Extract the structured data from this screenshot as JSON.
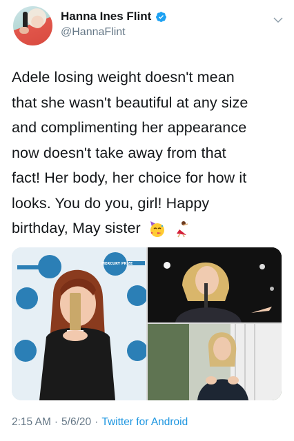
{
  "author": {
    "display_name": "Hanna Ines Flint",
    "handle": "@HannaFlint",
    "verified": true,
    "avatar_icon": "profile-photo"
  },
  "tweet": {
    "text_lines": [
      "Adele losing weight doesn't mean",
      "that she wasn't beautiful at any size",
      "and complimenting her appearance",
      "now doesn't take away from that",
      "fact! Her body, her choice for how it",
      "looks. You do you, girl! Happy",
      "birthday, May sister"
    ],
    "emojis": [
      "partying-face-emoji",
      "dancer-emoji"
    ]
  },
  "media": {
    "images": [
      {
        "name": "adele-award-photo",
        "award_banner_text": "MERCURY PRIZE"
      },
      {
        "name": "adele-concert-photo"
      },
      {
        "name": "adele-outdoor-photo"
      }
    ]
  },
  "footer": {
    "time": "2:15 AM",
    "separator": "·",
    "date": "5/6/20",
    "separator2": "·",
    "source": "Twitter for Android"
  },
  "colors": {
    "text": "#14171a",
    "secondary": "#657786",
    "link": "#1b95e0",
    "verified": "#1da1f2"
  }
}
